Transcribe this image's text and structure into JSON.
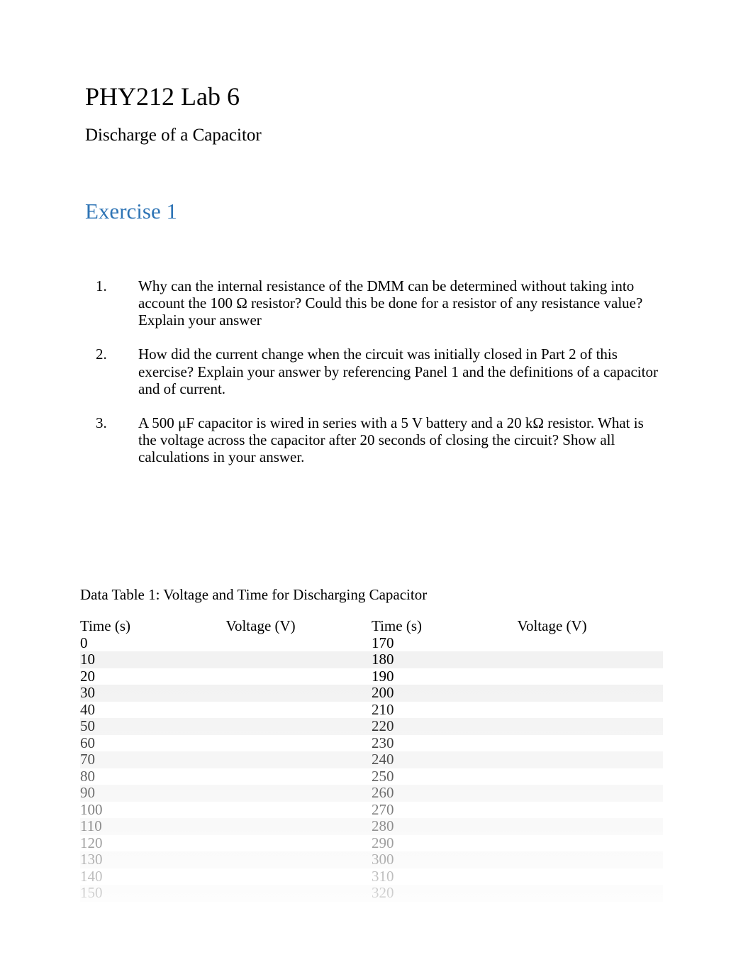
{
  "title": "PHY212 Lab 6",
  "subtitle": "Discharge of a Capacitor",
  "section_heading": "Exercise 1",
  "questions": [
    {
      "num": "1.",
      "text": "Why can the internal resistance of the DMM can be determined without taking into account the 100 Ω resistor? Could this be done for a resistor of any resistance value? Explain your answer"
    },
    {
      "num": "2.",
      "text": "How did the current change when the circuit was initially closed in Part 2 of this exercise? Explain your answer by referencing Panel 1 and the definitions of a capacitor and of current."
    },
    {
      "num": "3.",
      "text": "A 500 μF capacitor is wired in series with a 5 V battery and a 20 kΩ resistor. What is the voltage across the capacitor after 20 seconds of closing the circuit? Show all calculations in your answer."
    }
  ],
  "table": {
    "caption": "Data Table 1: Voltage and Time for Discharging Capacitor",
    "headers": {
      "time_a": "Time (s)",
      "volt_a": "Voltage (V)",
      "time_b": "Time (s)",
      "volt_b": "Voltage (V)"
    },
    "rows": [
      {
        "time_a": "0",
        "volt_a": "",
        "time_b": "170",
        "volt_b": ""
      },
      {
        "time_a": "10",
        "volt_a": "",
        "time_b": "180",
        "volt_b": ""
      },
      {
        "time_a": "20",
        "volt_a": "",
        "time_b": "190",
        "volt_b": ""
      },
      {
        "time_a": "30",
        "volt_a": "",
        "time_b": "200",
        "volt_b": ""
      },
      {
        "time_a": "40",
        "volt_a": "",
        "time_b": "210",
        "volt_b": ""
      },
      {
        "time_a": "50",
        "volt_a": "",
        "time_b": "220",
        "volt_b": ""
      },
      {
        "time_a": "60",
        "volt_a": "",
        "time_b": "230",
        "volt_b": ""
      },
      {
        "time_a": "70",
        "volt_a": "",
        "time_b": "240",
        "volt_b": ""
      },
      {
        "time_a": "80",
        "volt_a": "",
        "time_b": "250",
        "volt_b": ""
      },
      {
        "time_a": "90",
        "volt_a": "",
        "time_b": "260",
        "volt_b": ""
      },
      {
        "time_a": "100",
        "volt_a": "",
        "time_b": "270",
        "volt_b": ""
      },
      {
        "time_a": "110",
        "volt_a": "",
        "time_b": "280",
        "volt_b": ""
      },
      {
        "time_a": "120",
        "volt_a": "",
        "time_b": "290",
        "volt_b": ""
      },
      {
        "time_a": "130",
        "volt_a": "",
        "time_b": "300",
        "volt_b": ""
      },
      {
        "time_a": "140",
        "volt_a": "",
        "time_b": "310",
        "volt_b": ""
      },
      {
        "time_a": "150",
        "volt_a": "",
        "time_b": "320",
        "volt_b": ""
      }
    ]
  }
}
